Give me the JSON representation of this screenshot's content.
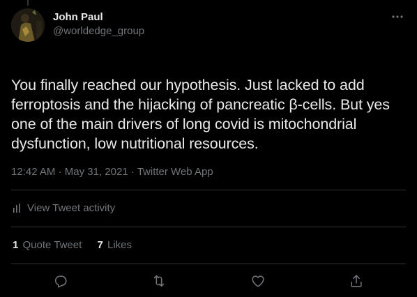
{
  "author": {
    "display_name": "John Paul",
    "handle": "@worldedge_group"
  },
  "more_icon": "more-horizontal-icon",
  "tweet": {
    "text": "You finally reached our hypothesis. Just lacked to add ferroptosis and the hijacking of pancreatic β-cells. But yes one of the main drivers of long covid is mitochondrial dysfunction, low nutritional resources."
  },
  "meta": {
    "time": "12:42 AM",
    "separator": "·",
    "date": "May 31, 2021",
    "source": "Twitter Web App"
  },
  "activity": {
    "label": "View Tweet activity",
    "icon": "bar-chart-icon"
  },
  "stats": {
    "quote_count": "1",
    "quote_label": "Quote Tweet",
    "like_count": "7",
    "like_label": "Likes"
  },
  "actions": {
    "reply_icon": "reply-icon",
    "retweet_icon": "retweet-icon",
    "like_icon": "heart-icon",
    "share_icon": "share-icon"
  },
  "colors": {
    "background": "#000000",
    "primary_text": "#e7e9ea",
    "secondary_text": "#71767b",
    "divider": "#2f3336"
  }
}
